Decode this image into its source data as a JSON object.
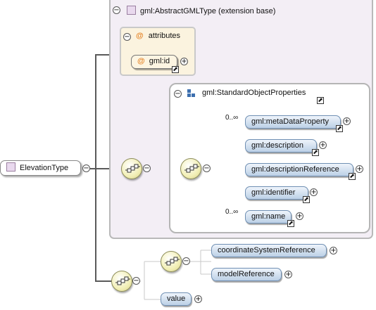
{
  "colors": {
    "element_fill": "#bcd0e6",
    "attribute_fill": "#fbf3df",
    "extension_fill": "#f3eef5",
    "compositor_fill": "#f2efb6"
  },
  "root": {
    "label": "ElevationType",
    "icon": "complex-type-icon"
  },
  "extension": {
    "header": "gml:AbstractGMLType (extension base)",
    "icon": "complex-type-icon"
  },
  "attributes": {
    "header": "attributes",
    "icon": "at-icon",
    "items": [
      {
        "label": "gml:id"
      }
    ]
  },
  "group": {
    "header": "gml:StandardObjectProperties",
    "icon": "group-icon"
  },
  "group_elements": [
    {
      "label": "gml:metaDataProperty",
      "multiplicity": "0..∞"
    },
    {
      "label": "gml:description",
      "multiplicity": ""
    },
    {
      "label": "gml:descriptionReference",
      "multiplicity": ""
    },
    {
      "label": "gml:identifier",
      "multiplicity": ""
    },
    {
      "label": "gml:name",
      "multiplicity": "0..∞"
    }
  ],
  "choice_elements": [
    {
      "label": "coordinateSystemReference"
    },
    {
      "label": "modelReference"
    }
  ],
  "sequence_elements": [
    {
      "label": "value"
    }
  ],
  "glyphs": {
    "collapse": "−",
    "expand": "+",
    "external": "⬈",
    "at": "@"
  }
}
